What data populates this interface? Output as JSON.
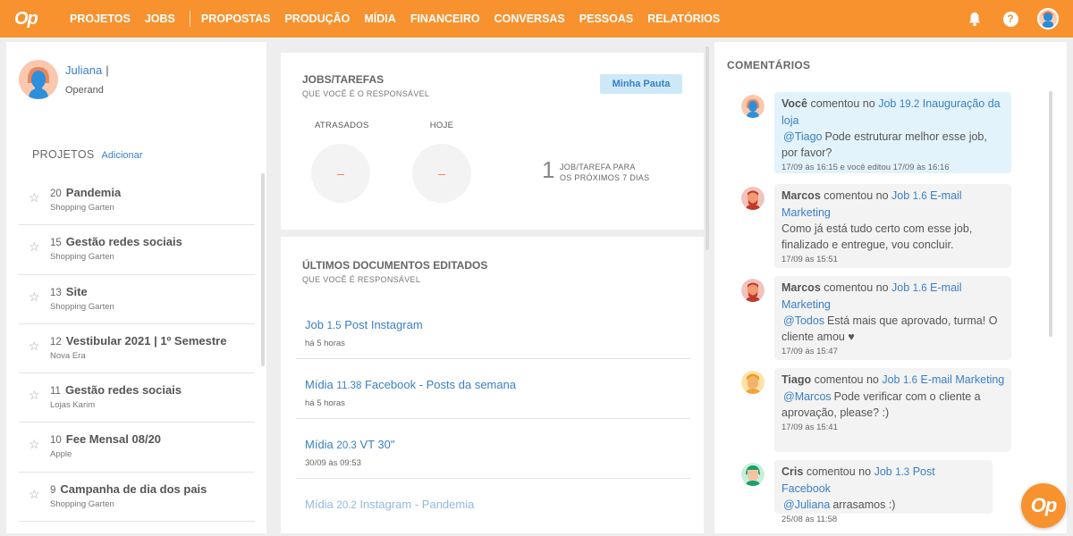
{
  "brand": {
    "logo_text": "Op",
    "accent": "#f7922f",
    "link_color": "#3a7fc3"
  },
  "nav": {
    "items_a": [
      "PROJETOS",
      "JOBS"
    ],
    "items_b": [
      "PROPOSTAS",
      "PRODUÇÃO",
      "MÍDIA",
      "FINANCEIRO",
      "CONVERSAS",
      "PESSOAS",
      "RELATÓRIOS"
    ]
  },
  "top_icons": {
    "bell": "bell-icon",
    "help_glyph": "?",
    "avatar": "user-avatar"
  },
  "user": {
    "name": "Juliana",
    "separator": "|",
    "organization": "Operand"
  },
  "projects": {
    "title": "PROJETOS",
    "add_label": "Adicionar",
    "items": [
      {
        "num": "20",
        "name": "Pandemia",
        "client": "Shopping Garten"
      },
      {
        "num": "15",
        "name": "Gestão redes sociais",
        "client": "Shopping Garten"
      },
      {
        "num": "13",
        "name": "Site",
        "client": "Shopping Garten"
      },
      {
        "num": "12",
        "name": "Vestibular 2021 | 1º Semestre",
        "client": "Nova Era"
      },
      {
        "num": "11",
        "name": "Gestão redes sociais",
        "client": "Lojas Karim"
      },
      {
        "num": "10",
        "name": "Fee Mensal 08/20",
        "client": "Apple"
      },
      {
        "num": "9",
        "name": "Campanha de dia dos pais",
        "client": "Shopping Garten"
      }
    ]
  },
  "jobs": {
    "title": "JOBS/TAREFAS",
    "subtitle": "QUE VOCÊ É O RESPONSÁVEL",
    "button": "Minha Pauta",
    "late_label": "ATRASADOS",
    "late_value": "–",
    "today_label": "HOJE",
    "today_value": "–",
    "week_count": "1",
    "week_line1": "JOB/TAREFA PARA",
    "week_line2": "OS PRÓXIMOS 7 DIAS"
  },
  "docs": {
    "title": "ÚLTIMOS DOCUMENTOS EDITADOS",
    "subtitle": "QUE VOCÊ É RESPONSÁVEL",
    "items": [
      {
        "prefix": "Job",
        "num": "1.5",
        "name": "Post Instagram",
        "time": "há 5 horas"
      },
      {
        "prefix": "Mídia",
        "num": "11.38",
        "name": "Facebook - Posts da semana",
        "time": "há 5 horas"
      },
      {
        "prefix": "Mídia",
        "num": "20.3",
        "name": "VT 30\"",
        "time": "30/09 às 09:53"
      },
      {
        "prefix": "Mídia",
        "num": "20.2",
        "name": "Instagram - Pandemia",
        "time": ""
      }
    ]
  },
  "comments": {
    "title": "COMENTÁRIOS",
    "verb": "comentou no",
    "items": [
      {
        "author": "Você",
        "job_prefix": "Job",
        "job_num": "19.2",
        "job_name": "Inauguração da loja",
        "mention": "@Tiago",
        "text": "Pode estruturar melhor esse job, por favor?",
        "time": "17/09 às 16:15 e você editou 17/09 às 16:16"
      },
      {
        "author": "Marcos",
        "job_prefix": "Job",
        "job_num": "1.6",
        "job_name": "E-mail Marketing",
        "mention": "",
        "text": "Como já está tudo certo com esse job, finalizado e entregue, vou concluir.",
        "time": "17/09 às 15:51"
      },
      {
        "author": "Marcos",
        "job_prefix": "Job",
        "job_num": "1.6",
        "job_name": "E-mail Marketing",
        "mention": "@Todos",
        "text": "Está mais que aprovado, turma! O cliente amou ♥",
        "time": "17/09 às 15:47"
      },
      {
        "author": "Tiago",
        "job_prefix": "Job",
        "job_num": "1.6",
        "job_name": "E-mail Marketing",
        "mention": "@Marcos",
        "text": "Pode verificar com o cliente a aprovação, please? :)",
        "time": "17/09 às 15:41"
      },
      {
        "author": "Cris",
        "job_prefix": "Job",
        "job_num": "1.3",
        "job_name": "Post Facebook",
        "mention": "@Juliana",
        "text": "arrasamos :)",
        "time": "25/08 às 11:58"
      }
    ]
  },
  "fab": {
    "label": "Op"
  }
}
